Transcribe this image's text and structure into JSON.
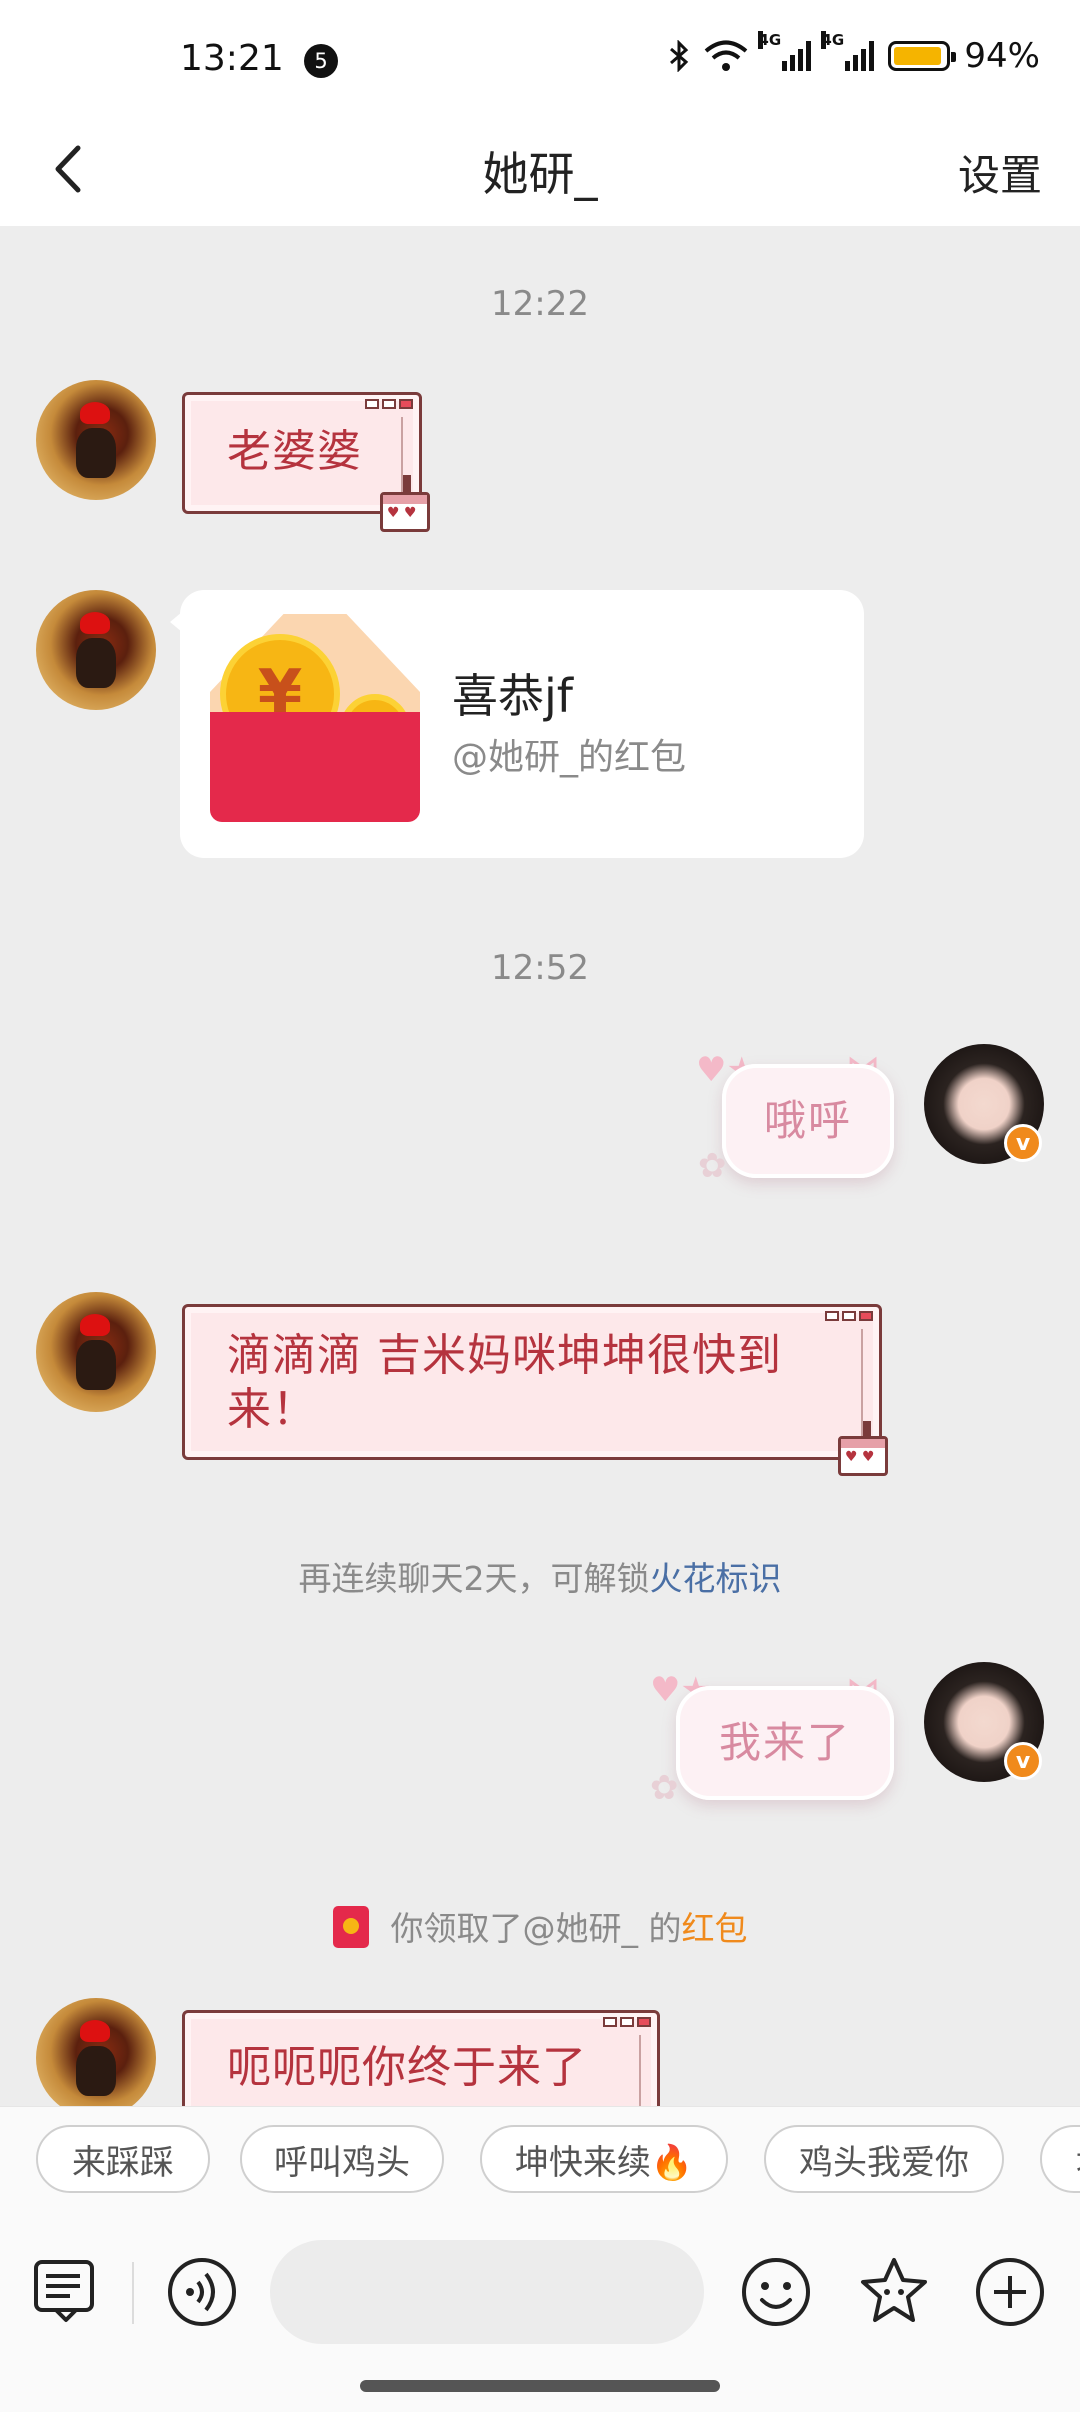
{
  "status_bar": {
    "time": "13:21",
    "notification_count": "5",
    "network_1": "4G",
    "network_2": "4G",
    "battery_percent": "94%",
    "battery_level": 0.94,
    "battery_color": "#f5b400"
  },
  "nav": {
    "back_icon": "chevron-left-icon",
    "title": "她研_",
    "settings_label": "设置"
  },
  "chat": {
    "timestamps": [
      "12:22",
      "12:52"
    ],
    "messages": [
      {
        "side": "left",
        "type": "text",
        "text": "老婆婆"
      },
      {
        "side": "left",
        "type": "red_packet",
        "title": "喜恭jf",
        "subtitle": "@她研_的红包"
      },
      {
        "side": "right",
        "type": "text",
        "text": "哦呼"
      },
      {
        "side": "left",
        "type": "text",
        "text": "滴滴滴 吉米妈咪坤坤很快到来！"
      },
      {
        "side": "right",
        "type": "text",
        "text": "我来了"
      },
      {
        "side": "left",
        "type": "text",
        "text": "呃呃呃你终于来了"
      }
    ],
    "streak_notice": {
      "text": "再连续聊天2天，可解锁",
      "link": "火花标识"
    },
    "packet_notice": {
      "text": "你领取了@她研_ 的",
      "highlight": "红包"
    }
  },
  "quick_replies": [
    "来踩踩",
    "呼叫鸡头",
    "坤快来续🔥",
    "鸡头我爱你",
    "坤"
  ],
  "input_bar": {
    "icons": [
      "chat-list-icon",
      "voice-icon",
      "emoji-icon",
      "sticker-icon",
      "plus-icon"
    ],
    "placeholder": ""
  },
  "colors": {
    "accent_orange": "#f08a1c",
    "link_blue": "#4a6fa5",
    "bubble_red_text": "#b5333e",
    "bubble_pink_text": "#d88aa0"
  }
}
